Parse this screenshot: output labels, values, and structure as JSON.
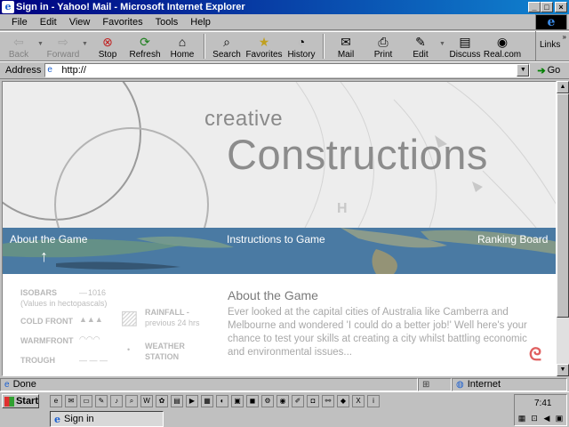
{
  "window": {
    "title": "Sign in - Yahoo! Mail - Microsoft Internet Explorer",
    "controls": [
      "_",
      "□",
      "×"
    ]
  },
  "menu": [
    "File",
    "Edit",
    "View",
    "Favorites",
    "Tools",
    "Help"
  ],
  "toolbar": {
    "back": "Back",
    "forward": "Forward",
    "stop": "Stop",
    "refresh": "Refresh",
    "home": "Home",
    "search": "Search",
    "favorites": "Favorites",
    "history": "History",
    "mail": "Mail",
    "print": "Print",
    "edit": "Edit",
    "discuss": "Discuss",
    "real": "Real.com",
    "links": "Links"
  },
  "address": {
    "label": "Address",
    "value": "http://",
    "go": "Go"
  },
  "page": {
    "brand_small": "creative",
    "brand_large": "Constructions",
    "map_mark": "H",
    "nav": {
      "about": "About the Game",
      "instructions": "Instructions to Game",
      "ranking": "Ranking Board"
    },
    "legend": {
      "isobars": "ISOBARS",
      "isobars_value": "1016",
      "isobars_note": "(Values in hectopascals)",
      "cold_front": "COLD FRONT",
      "warm_front": "WARMFRONT",
      "trough": "TROUGH",
      "rainfall": "RAINFALL -",
      "rainfall_note": "previous 24 hrs",
      "weather": "WEATHER",
      "station": "STATION"
    },
    "about_title": "About the Game",
    "about_text": "Ever looked at the capital cities of Australia like Camberra and Melbourne and wondered 'I could do a better job!' Well here's your chance to test your skills at creating a city whilst battling economic and environmental issues..."
  },
  "status": {
    "text": "Done",
    "zone": "Internet"
  },
  "taskbar": {
    "start": "Start",
    "task": "Sign in",
    "clock": "7:41"
  }
}
